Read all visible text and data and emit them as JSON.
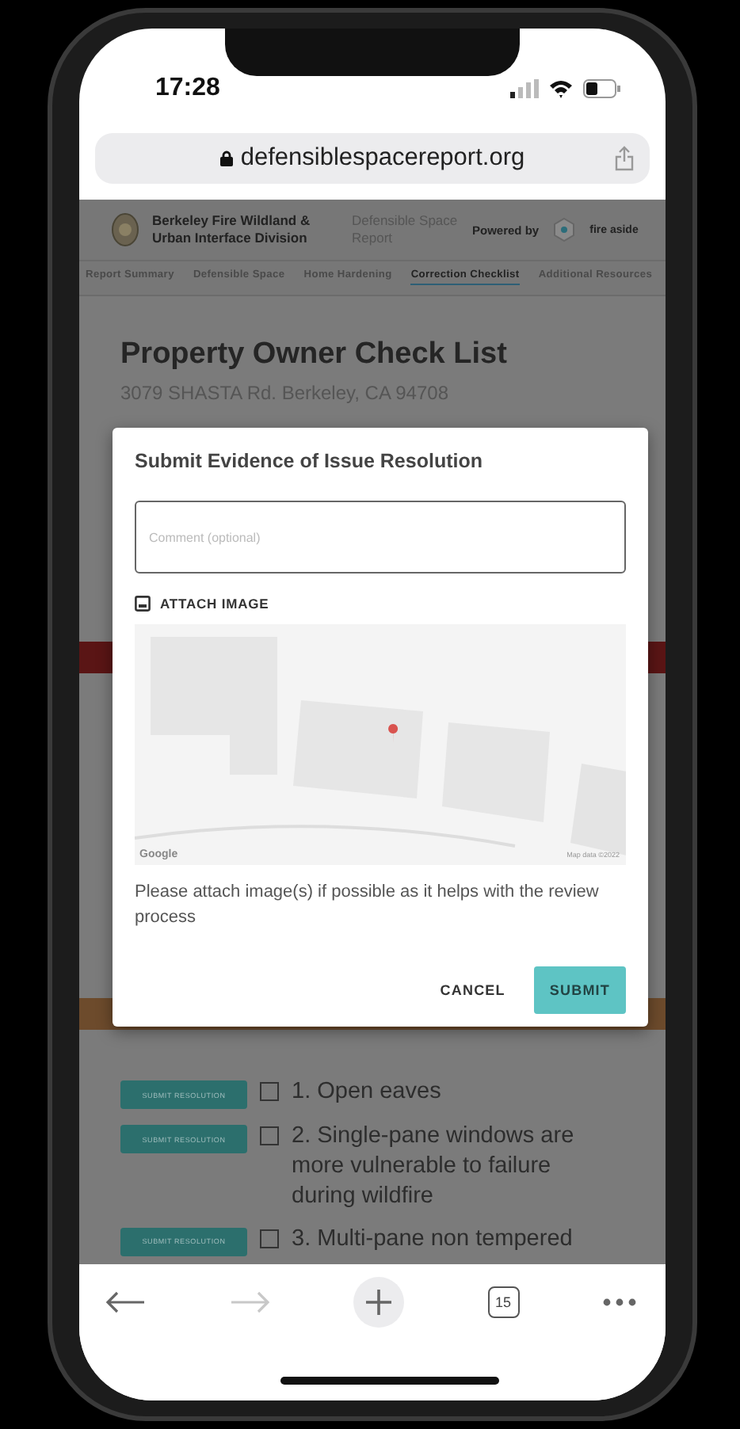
{
  "status_bar": {
    "time": "17:28"
  },
  "address_bar": {
    "url": "defensiblespacereport.org"
  },
  "site_header": {
    "organization": "Berkeley Fire Wildland & Urban Interface Division",
    "product": "Defensible Space Report",
    "powered_by": "Powered by",
    "partner": "fire aside"
  },
  "nav_tabs": [
    {
      "label": "Report Summary",
      "selected": false
    },
    {
      "label": "Defensible Space",
      "selected": false
    },
    {
      "label": "Home Hardening",
      "selected": false
    },
    {
      "label": "Correction Checklist",
      "selected": true
    },
    {
      "label": "Additional Resources",
      "selected": false
    }
  ],
  "page": {
    "title": "Property Owner Check List",
    "address": "3079 SHASTA Rd. Berkeley, CA 94708"
  },
  "dialog": {
    "title": "Submit Evidence of Issue Resolution",
    "comment": {
      "placeholder": "Comment (optional)"
    },
    "attach_label": "ATTACH IMAGE",
    "map": {
      "logo": "Google",
      "attribution": "Map data ©2022"
    },
    "hint": "Please attach image(s) if possible as it helps with the review process",
    "buttons": [
      {
        "label": "CANCEL",
        "kind": "text"
      },
      {
        "label": "SUBMIT",
        "kind": "filled"
      }
    ]
  },
  "checklist": [
    {
      "button": "SUBMIT RESOLUTION",
      "checked": false,
      "text": "1. Open eaves"
    },
    {
      "button": "SUBMIT RESOLUTION",
      "checked": false,
      "text": "2. Single-pane windows are more vulnerable to failure during wildfire"
    },
    {
      "button": "SUBMIT RESOLUTION",
      "checked": false,
      "text": "3. Multi-pane non tempered"
    }
  ],
  "toolbar": {
    "tab_count": "15"
  }
}
